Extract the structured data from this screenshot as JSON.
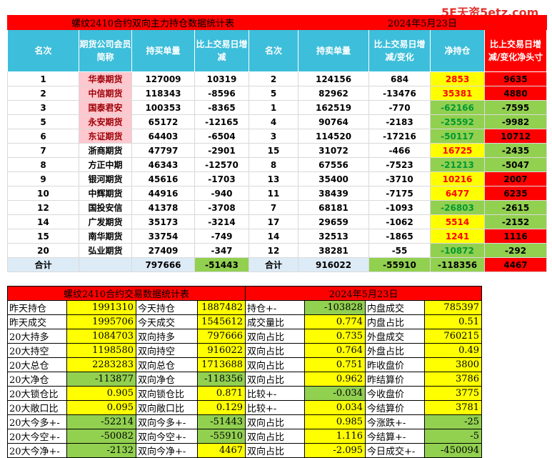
{
  "watermark": "5E天资5etz.com",
  "futures_table": {
    "title_left": "螺纹2410合约双向主力持仓数据统计表",
    "title_right": "2024年5月23日",
    "headers": [
      "名次",
      "期货公司会员简称",
      "持买单量",
      "比上交易日增减",
      "名次",
      "持卖单量",
      "比上交易日增减/变化",
      "净持仓",
      "比上交易日增减/变化净头寸"
    ],
    "rows": [
      {
        "rank_buy": "1",
        "firm": "华泰期货",
        "buy": "127009",
        "buy_chg": "10319",
        "rank_sell": "2",
        "sell": "124156",
        "sell_chg": "684",
        "net": "2853",
        "net_chg": "9635",
        "net_color": "yellow",
        "chg_color": "red",
        "firm_pink": true
      },
      {
        "rank_buy": "2",
        "firm": "中信期货",
        "buy": "118343",
        "buy_chg": "-8596",
        "rank_sell": "5",
        "sell": "82962",
        "sell_chg": "-13476",
        "net": "35381",
        "net_chg": "4880",
        "net_color": "yellow",
        "chg_color": "red",
        "firm_pink": true
      },
      {
        "rank_buy": "3",
        "firm": "国泰君安",
        "buy": "100353",
        "buy_chg": "-8365",
        "rank_sell": "1",
        "sell": "162519",
        "sell_chg": "-770",
        "net": "-62166",
        "net_chg": "-7595",
        "net_color": "green",
        "chg_color": "green",
        "firm_pink": true
      },
      {
        "rank_buy": "5",
        "firm": "永安期货",
        "buy": "65172",
        "buy_chg": "-12165",
        "rank_sell": "4",
        "sell": "90764",
        "sell_chg": "-2183",
        "net": "-25592",
        "net_chg": "-9982",
        "net_color": "green",
        "chg_color": "green",
        "firm_pink": true
      },
      {
        "rank_buy": "6",
        "firm": "东证期货",
        "buy": "64403",
        "buy_chg": "-6504",
        "rank_sell": "3",
        "sell": "114520",
        "sell_chg": "-17216",
        "net": "-50117",
        "net_chg": "10712",
        "net_color": "green",
        "chg_color": "red",
        "firm_pink": true
      },
      {
        "rank_buy": "7",
        "firm": "浙商期货",
        "buy": "47797",
        "buy_chg": "-2901",
        "rank_sell": "15",
        "sell": "31072",
        "sell_chg": "-466",
        "net": "16725",
        "net_chg": "-2435",
        "net_color": "yellow",
        "chg_color": "green",
        "firm_pink": false
      },
      {
        "rank_buy": "8",
        "firm": "方正中期",
        "buy": "46343",
        "buy_chg": "-12570",
        "rank_sell": "8",
        "sell": "67556",
        "sell_chg": "-7523",
        "net": "-21213",
        "net_chg": "-5047",
        "net_color": "green",
        "chg_color": "green",
        "firm_pink": false
      },
      {
        "rank_buy": "9",
        "firm": "银河期货",
        "buy": "45616",
        "buy_chg": "-1703",
        "rank_sell": "13",
        "sell": "35400",
        "sell_chg": "-3710",
        "net": "10216",
        "net_chg": "2007",
        "net_color": "yellow",
        "chg_color": "red",
        "firm_pink": false
      },
      {
        "rank_buy": "10",
        "firm": "中辉期货",
        "buy": "44916",
        "buy_chg": "-940",
        "rank_sell": "11",
        "sell": "38439",
        "sell_chg": "-7175",
        "net": "6477",
        "net_chg": "6235",
        "net_color": "yellow",
        "chg_color": "red",
        "firm_pink": false
      },
      {
        "rank_buy": "12",
        "firm": "国投安信",
        "buy": "41378",
        "buy_chg": "-3708",
        "rank_sell": "7",
        "sell": "68181",
        "sell_chg": "-1093",
        "net": "-26803",
        "net_chg": "-2615",
        "net_color": "green",
        "chg_color": "green",
        "firm_pink": false
      },
      {
        "rank_buy": "14",
        "firm": "广发期货",
        "buy": "35173",
        "buy_chg": "-3214",
        "rank_sell": "17",
        "sell": "29659",
        "sell_chg": "-1062",
        "net": "5514",
        "net_chg": "-2152",
        "net_color": "yellow",
        "chg_color": "green",
        "firm_pink": false
      },
      {
        "rank_buy": "15",
        "firm": "南华期货",
        "buy": "33754",
        "buy_chg": "-749",
        "rank_sell": "14",
        "sell": "32513",
        "sell_chg": "-1865",
        "net": "1241",
        "net_chg": "1116",
        "net_color": "yellow",
        "chg_color": "red",
        "firm_pink": false
      },
      {
        "rank_buy": "20",
        "firm": "弘业期货",
        "buy": "27409",
        "buy_chg": "-347",
        "rank_sell": "12",
        "sell": "38281",
        "sell_chg": "-55",
        "net": "-10872",
        "net_chg": "-292",
        "net_color": "green",
        "chg_color": "green",
        "firm_pink": false
      }
    ],
    "total": {
      "label": "合计",
      "buy": "797666",
      "buy_chg": "-51443",
      "label2": "合计",
      "sell": "916022",
      "sell_chg": "-55910",
      "net": "-118356",
      "net_chg": "4467"
    }
  },
  "stats_table": {
    "title_left": "螺纹2410合约交易数据统计表",
    "title_right": "2024年5月23日",
    "rows": [
      {
        "l1": "昨天持仓",
        "v1": "1991310",
        "v1c": "yellow",
        "l2": "今天持仓",
        "v2": "1887482",
        "v2c": "yellow",
        "l3": "持仓+-",
        "v3": "-103828",
        "v3c": "green",
        "l4": "内盘成交",
        "v4": "785397",
        "v4c": "yellow"
      },
      {
        "l1": "昨天成交",
        "v1": "1995706",
        "v1c": "yellow",
        "l2": "今天成交",
        "v2": "1545612",
        "v2c": "yellow",
        "l3": "成交量比",
        "v3": "0.774",
        "v3c": "yellow",
        "l4": "内盘占比",
        "v4": "0.51",
        "v4c": "yellow"
      },
      {
        "l1": "20大持多",
        "v1": "1084703",
        "v1c": "yellow",
        "l2": "双向持多",
        "v2": "797666",
        "v2c": "yellow",
        "l3": "双向占比",
        "v3": "0.735",
        "v3c": "yellow",
        "l4": "外盘成交",
        "v4": "760215",
        "v4c": "yellow"
      },
      {
        "l1": "20大持空",
        "v1": "1198580",
        "v1c": "yellow",
        "l2": "双向持空",
        "v2": "916022",
        "v2c": "yellow",
        "l3": "双向占比",
        "v3": "0.764",
        "v3c": "yellow",
        "l4": "外盘占比",
        "v4": "0.49",
        "v4c": "yellow"
      },
      {
        "l1": "20大总仓",
        "v1": "2283283",
        "v1c": "yellow",
        "l2": "双向总仓",
        "v2": "1713688",
        "v2c": "yellow",
        "l3": "双向占比",
        "v3": "0.751",
        "v3c": "yellow",
        "l4": "昨收盘价",
        "v4": "3800",
        "v4c": "yellow"
      },
      {
        "l1": "20大净仓",
        "v1": "-113877",
        "v1c": "green",
        "l2": "双向净仓",
        "v2": "-118356",
        "v2c": "green",
        "l3": "双向占比",
        "v3": "0.962",
        "v3c": "yellow",
        "l4": "昨结算价",
        "v4": "3786",
        "v4c": "yellow"
      },
      {
        "l1": "20大锁仓比",
        "v1": "0.905",
        "v1c": "yellow",
        "l2": "双向锁仓比",
        "v2": "0.871",
        "v2c": "yellow",
        "l3": "比较+-",
        "v3": "-0.034",
        "v3c": "green",
        "l4": "今收盘价",
        "v4": "3775",
        "v4c": "yellow"
      },
      {
        "l1": "20大敞口比",
        "v1": "0.095",
        "v1c": "yellow",
        "l2": "双向敞口比",
        "v2": "0.129",
        "v2c": "yellow",
        "l3": "比较+-",
        "v3": "0.034",
        "v3c": "yellow",
        "l4": "今结算价",
        "v4": "3781",
        "v4c": "yellow"
      },
      {
        "l1": "20大今多+-",
        "v1": "-52214",
        "v1c": "green",
        "l2": "双向今多+-",
        "v2": "-51443",
        "v2c": "green",
        "l3": "双向占比",
        "v3": "0.985",
        "v3c": "yellow",
        "l4": "今涨跌+-",
        "v4": "-25",
        "v4c": "green"
      },
      {
        "l1": "20大今空+-",
        "v1": "-50082",
        "v1c": "green",
        "l2": "双向今空+-",
        "v2": "-55910",
        "v2c": "green",
        "l3": "双向占比",
        "v3": "1.116",
        "v3c": "yellow",
        "l4": "今结算+-",
        "v4": "-5",
        "v4c": "green"
      },
      {
        "l1": "20大今净+-",
        "v1": "-2132",
        "v1c": "green",
        "l2": "双向今净+-",
        "v2": "4467",
        "v2c": "yellow",
        "l3": "双向占比",
        "v3": "-2.095",
        "v3c": "yellow",
        "l4": "今日成交+-",
        "v4": "-450094",
        "v4c": "green"
      }
    ]
  }
}
